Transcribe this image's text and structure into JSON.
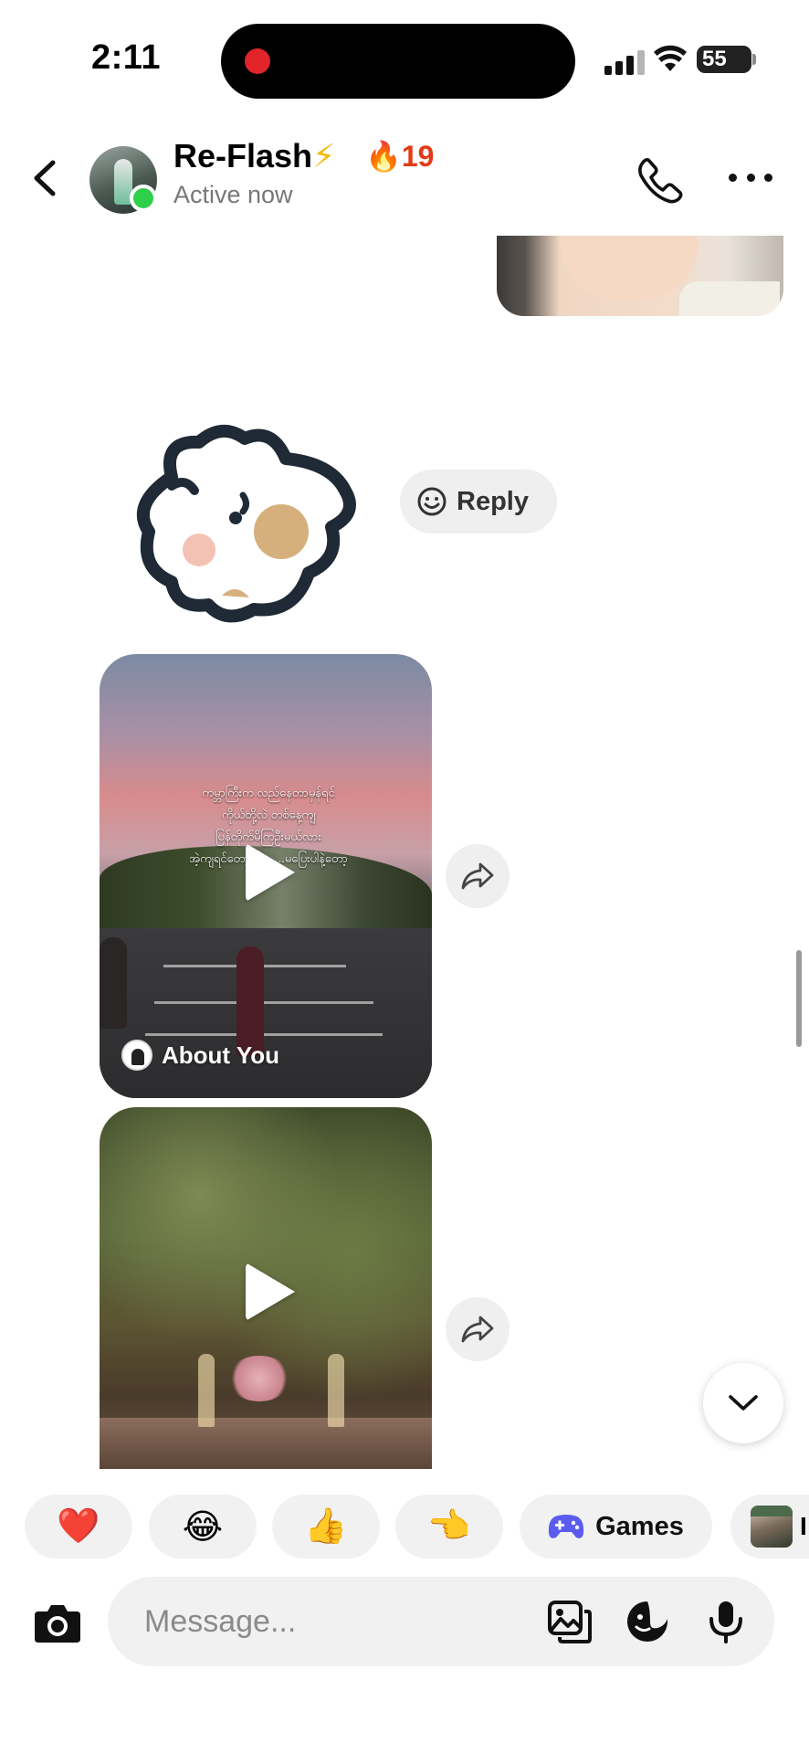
{
  "status_bar": {
    "time": "2:11",
    "battery": "55"
  },
  "header": {
    "name": "Re-Flash",
    "name_emoji": "⚡",
    "streak": "🔥19",
    "status": "Active now"
  },
  "messages": {
    "reply_label": "Reply",
    "video1": {
      "caption_lines": [
        "ကမ္ဘာကြီးက လည်နေတာမှန်ရင်",
        "ကိုယ်တို့လဲ တစ်နေ့ကျ",
        "ပြန်တိုက်မိကြဦးမယ်လား",
        "အဲ့ကျရင်တော့ ငြ... ...မပြေးပါနဲ့တော့"
      ],
      "author": "About You"
    }
  },
  "quick_replies": {
    "items": [
      "❤️",
      "😂",
      "👍",
      "👈"
    ],
    "games_label": "Games",
    "partial_label": "I"
  },
  "composer": {
    "placeholder": "Message..."
  },
  "colors": {
    "online": "#2ed04b",
    "streak": "#e23a18",
    "games_icon": "#5b5bf0",
    "recording": "#e0242a"
  }
}
